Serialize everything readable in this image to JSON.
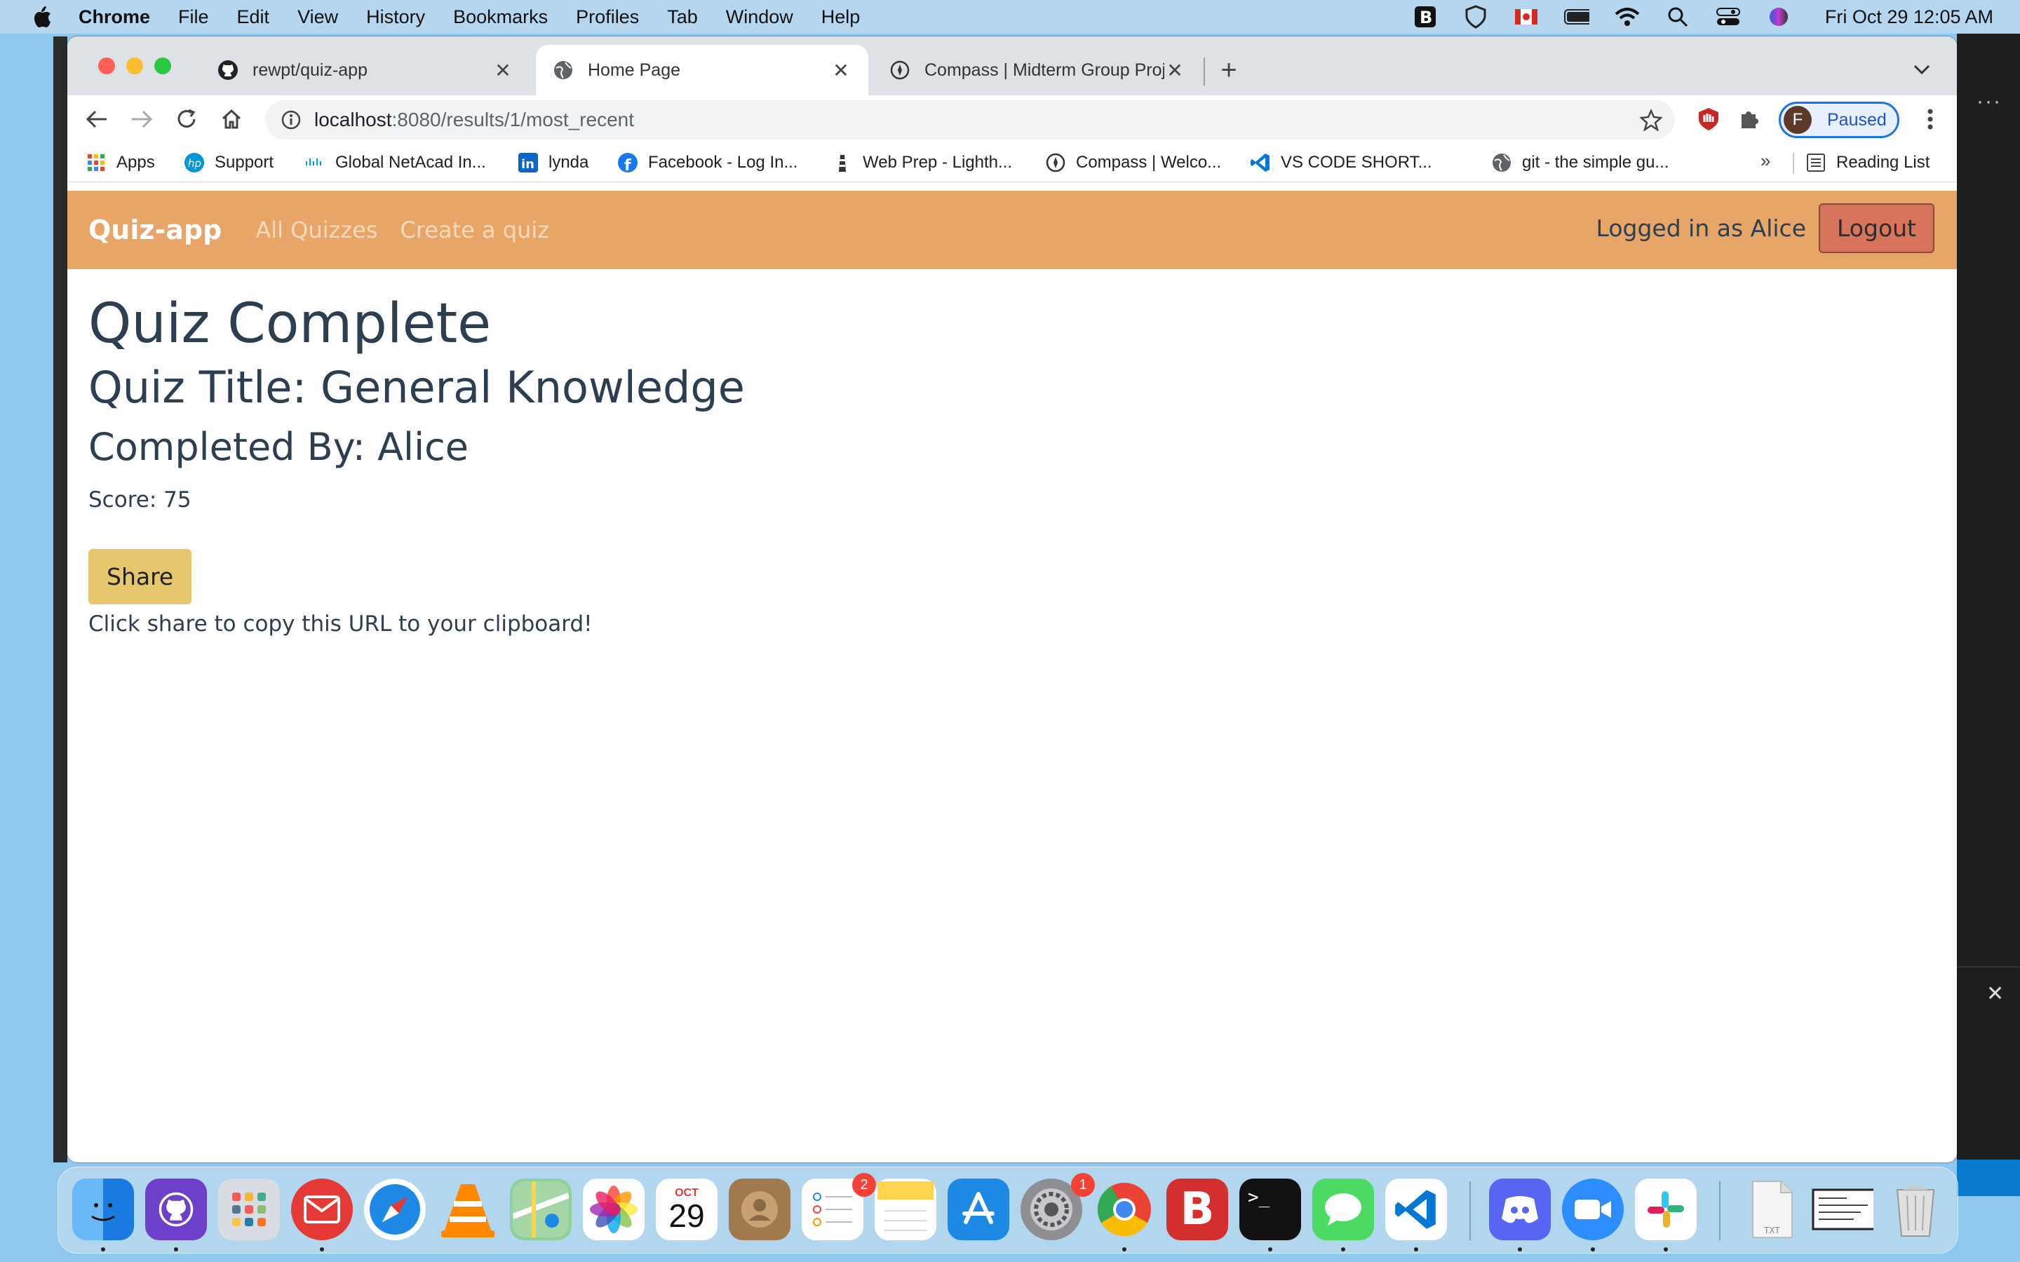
{
  "menubar": {
    "app": "Chrome",
    "items": [
      "File",
      "Edit",
      "View",
      "History",
      "Bookmarks",
      "Profiles",
      "Tab",
      "Window",
      "Help"
    ],
    "clock": "Fri Oct 29  12:05 AM"
  },
  "tabs": [
    {
      "title": "rewpt/quiz-app",
      "icon": "github-icon"
    },
    {
      "title": "Home Page",
      "icon": "globe-icon",
      "active": true
    },
    {
      "title": "Compass | Midterm Group Proj",
      "icon": "compass-icon"
    }
  ],
  "omnibox": {
    "host": "localhost",
    "path": ":8080/results/1/most_recent"
  },
  "profile": {
    "initial": "F",
    "status": "Paused"
  },
  "bookmarks": [
    {
      "label": "Apps",
      "icon": "apps-grid-icon"
    },
    {
      "label": "Support",
      "icon": "hp-icon"
    },
    {
      "label": "Global NetAcad In...",
      "icon": "cisco-icon"
    },
    {
      "label": "lynda",
      "icon": "linkedin-icon"
    },
    {
      "label": "Facebook - Log In...",
      "icon": "facebook-icon"
    },
    {
      "label": "Web Prep - Lighth...",
      "icon": "lighthouse-icon"
    },
    {
      "label": "Compass | Welco...",
      "icon": "compass-icon"
    },
    {
      "label": "VS CODE SHORT...",
      "icon": "vscode-icon"
    },
    {
      "label": "git - the simple gu...",
      "icon": "globe-icon"
    }
  ],
  "reading_list": "Reading List",
  "more_bookmarks": "»",
  "navbar": {
    "brand": "Quiz-app",
    "links": [
      "All Quizzes",
      "Create a quiz"
    ],
    "logged_in": "Logged in as Alice",
    "logout": "Logout"
  },
  "results": {
    "heading": "Quiz Complete",
    "quiz_title": "Quiz Title: General Knowledge",
    "completed_by": "Completed By: Alice",
    "score": "Score: 75",
    "share_button": "Share",
    "share_hint": "Click share to copy this URL to your clipboard!"
  },
  "dock": {
    "calendar_month": "OCT",
    "calendar_day": "29",
    "reminders_badge": "2",
    "settings_badge": "1"
  },
  "colors": {
    "navbar": "#e8a568",
    "logout": "#d9745c",
    "share": "#e6c76e",
    "text": "#2c3e50"
  }
}
